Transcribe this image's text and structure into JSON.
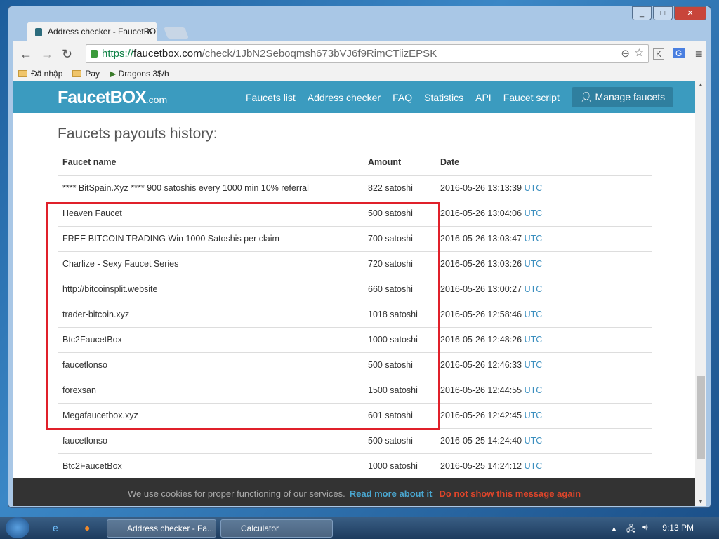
{
  "window": {
    "tab_title": "Address checker - FaucetBOX",
    "url_scheme": "https://",
    "url_domain": "faucetbox.com",
    "url_path": "/check/1JbN2Seboqmsh673bVJ6f9RimCTiizEPSK"
  },
  "bookmarks": [
    "Đã nhập",
    "Pay",
    "Dragons 3$/h"
  ],
  "site": {
    "logo": "FaucetBOX",
    "logo_suffix": ".com",
    "nav": [
      "Faucets list",
      "Address checker",
      "FAQ",
      "Statistics",
      "API",
      "Faucet script"
    ],
    "manage": "Manage faucets"
  },
  "main": {
    "title": "Faucets payouts history:",
    "columns": [
      "Faucet name",
      "Amount",
      "Date"
    ],
    "rows": [
      {
        "name": "**** BitSpain.Xyz **** 900 satoshis every 1000 min 10% referral",
        "amount": "822 satoshi",
        "date": "2016-05-26 13:13:39",
        "tz": "UTC"
      },
      {
        "name": "Heaven Faucet",
        "amount": "500 satoshi",
        "date": "2016-05-26 13:04:06",
        "tz": "UTC"
      },
      {
        "name": "FREE BITCOIN TRADING Win 1000 Satoshis per claim",
        "amount": "700 satoshi",
        "date": "2016-05-26 13:03:47",
        "tz": "UTC"
      },
      {
        "name": "Charlize - Sexy Faucet Series",
        "amount": "720 satoshi",
        "date": "2016-05-26 13:03:26",
        "tz": "UTC"
      },
      {
        "name": "http://bitcoinsplit.website",
        "amount": "660 satoshi",
        "date": "2016-05-26 13:00:27",
        "tz": "UTC"
      },
      {
        "name": "trader-bitcoin.xyz",
        "amount": "1018 satoshi",
        "date": "2016-05-26 12:58:46",
        "tz": "UTC"
      },
      {
        "name": "Btc2FaucetBox",
        "amount": "1000 satoshi",
        "date": "2016-05-26 12:48:26",
        "tz": "UTC"
      },
      {
        "name": "faucetlonso",
        "amount": "500 satoshi",
        "date": "2016-05-26 12:46:33",
        "tz": "UTC"
      },
      {
        "name": "forexsan",
        "amount": "1500 satoshi",
        "date": "2016-05-26 12:44:55",
        "tz": "UTC"
      },
      {
        "name": "Megafaucetbox.xyz",
        "amount": "601 satoshi",
        "date": "2016-05-26 12:42:45",
        "tz": "UTC"
      },
      {
        "name": "faucetlonso",
        "amount": "500 satoshi",
        "date": "2016-05-25 14:24:40",
        "tz": "UTC"
      },
      {
        "name": "Btc2FaucetBox",
        "amount": "1000 satoshi",
        "date": "2016-05-25 14:24:12",
        "tz": "UTC"
      }
    ]
  },
  "cookie": {
    "text": "We use cookies for proper functioning of our services.",
    "read_more": "Read more about it",
    "dismiss": "Do not show this message again"
  },
  "taskbar": {
    "items": [
      "Address checker - Fa...",
      "Calculator"
    ],
    "clock": "9:13 PM"
  },
  "colors": {
    "header": "#3b9bbf",
    "highlight_box": "#e0202a",
    "link": "#3b8fbf",
    "dismiss": "#e0452a"
  }
}
